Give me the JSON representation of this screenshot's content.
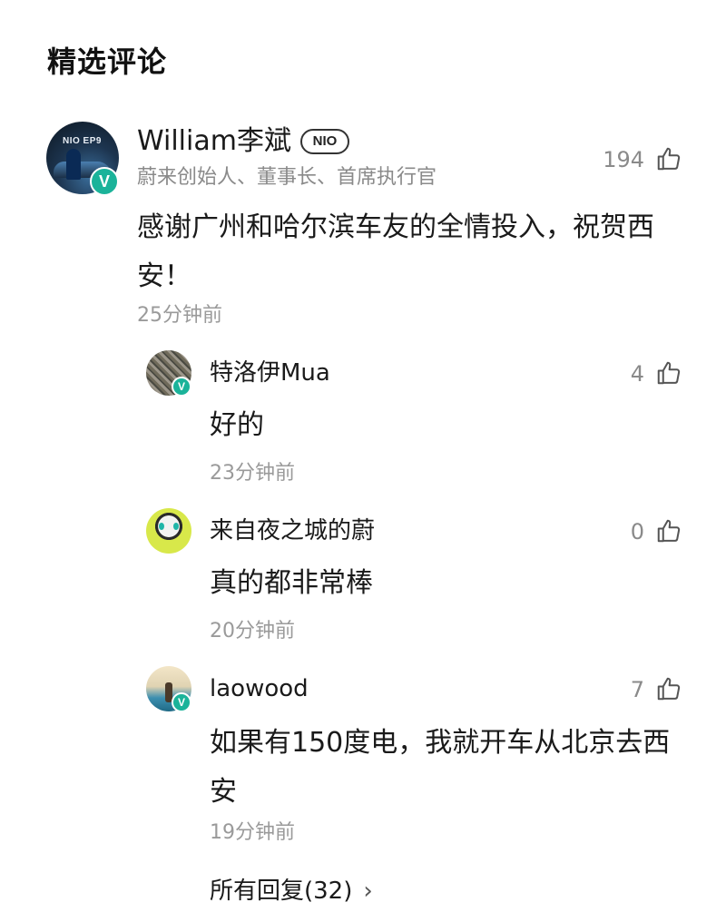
{
  "section": {
    "title": "精选评论"
  },
  "main_comment": {
    "author": "William李斌",
    "badge": "NIO",
    "avatar_logo": "NIO EP9",
    "author_title": "蔚来创始人、董事长、首席执行官",
    "text": "感谢广州和哈尔滨车友的全情投入，祝贺西安！",
    "time": "25分钟前",
    "likes": "194"
  },
  "replies": [
    {
      "author": "特洛伊Mua",
      "text": "好的",
      "time": "23分钟前",
      "likes": "4"
    },
    {
      "author": "来自夜之城的蔚",
      "text": "真的都非常棒",
      "time": "20分钟前",
      "likes": "0"
    },
    {
      "author": "laowood",
      "text": "如果有150度电，我就开车从北京去西安",
      "time": "19分钟前",
      "likes": "7"
    }
  ],
  "all_replies": {
    "label": "所有回复(32)"
  },
  "colors": {
    "verified": "#1bb39a",
    "meta_text": "#9a9a9a",
    "main_text": "#1a1a1a"
  },
  "icons": {
    "like": "thumbs-up-icon",
    "verified": "verified-v-icon",
    "more": "chevron-right-icon"
  }
}
